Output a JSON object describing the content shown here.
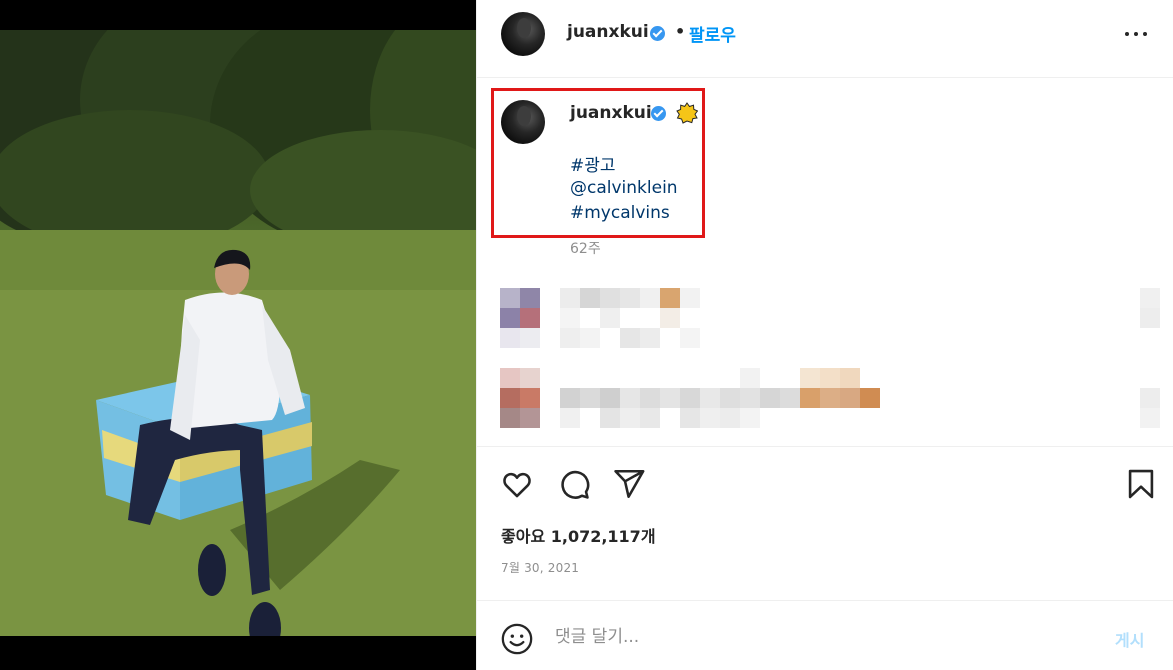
{
  "post": {
    "photo_alt": "",
    "header": {
      "username": "juanxkui",
      "separator": "•",
      "follow_label": "팔로우"
    },
    "caption": {
      "username": "juanxkui",
      "tags": [
        "#광고",
        "@calvinklein",
        "#mycalvins"
      ],
      "age": "62주"
    },
    "likes": {
      "label": "좋아요 1,072,117개"
    },
    "date": "7월 30, 2021",
    "comment_input": {
      "placeholder": "댓글 달기...",
      "value": ""
    },
    "post_label": "게시"
  },
  "icons": {
    "header": [
      "avatar",
      "verified-badge-icon",
      "more-options-icon"
    ],
    "actions": [
      "heart-icon",
      "comment-icon",
      "share-icon",
      "bookmark-icon"
    ],
    "input": [
      "emoji-icon"
    ]
  },
  "colors": {
    "link": "#00376b",
    "follow": "#0095f6",
    "verified": "#3797f0",
    "highlight_box": "#e01818",
    "muted_text": "#8e8e8e",
    "post_button_disabled": "#b2dffc"
  }
}
